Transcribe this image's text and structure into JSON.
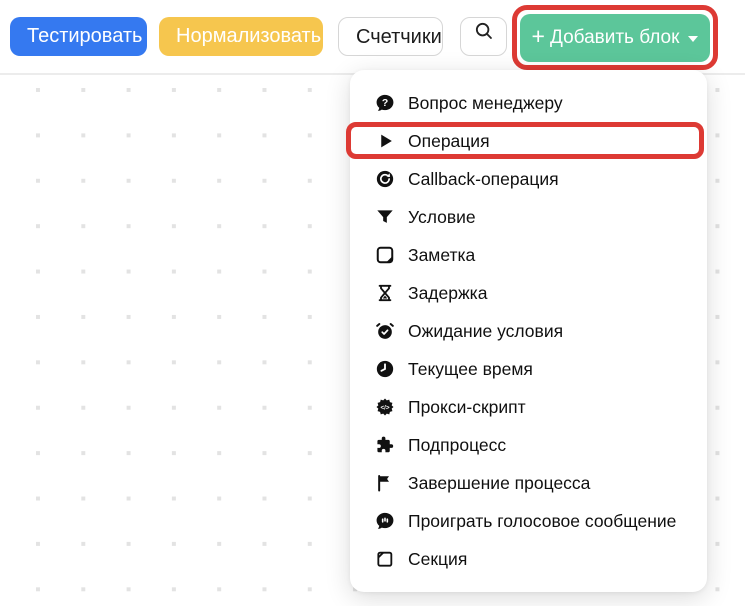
{
  "toolbar": {
    "buttons": {
      "test": "Тестировать",
      "normalize": "Нормализовать",
      "counters": "Счетчики",
      "add_block_plus": "+",
      "add_block": "Добавить блок"
    },
    "search_icon": "search-icon",
    "add_block_caret_icon": "caret-down-icon"
  },
  "colors": {
    "primary_blue": "#3579f0",
    "accent_yellow": "#f6c64e",
    "accent_green": "#5cc69a",
    "annotation_red": "#dd3a34"
  },
  "menu": {
    "items": [
      {
        "label": "Вопрос менеджеру",
        "icon": "question-bubble-icon",
        "highlighted": false
      },
      {
        "label": "Операция",
        "icon": "play-icon",
        "highlighted": true
      },
      {
        "label": "Callback-операция",
        "icon": "callback-icon",
        "highlighted": false
      },
      {
        "label": "Условие",
        "icon": "filter-icon",
        "highlighted": false
      },
      {
        "label": "Заметка",
        "icon": "note-icon",
        "highlighted": false
      },
      {
        "label": "Задержка",
        "icon": "hourglass-icon",
        "highlighted": false
      },
      {
        "label": "Ожидание условия",
        "icon": "alarm-check-icon",
        "highlighted": false
      },
      {
        "label": "Текущее время",
        "icon": "clock-icon",
        "highlighted": false
      },
      {
        "label": "Прокси-скрипт",
        "icon": "proxy-script-icon",
        "highlighted": false
      },
      {
        "label": "Подпроцесс",
        "icon": "puzzle-icon",
        "highlighted": false
      },
      {
        "label": "Завершение процесса",
        "icon": "flag-icon",
        "highlighted": false
      },
      {
        "label": "Проиграть голосовое сообщение",
        "icon": "voice-message-icon",
        "highlighted": false
      },
      {
        "label": "Секция",
        "icon": "section-icon",
        "highlighted": false
      }
    ]
  }
}
